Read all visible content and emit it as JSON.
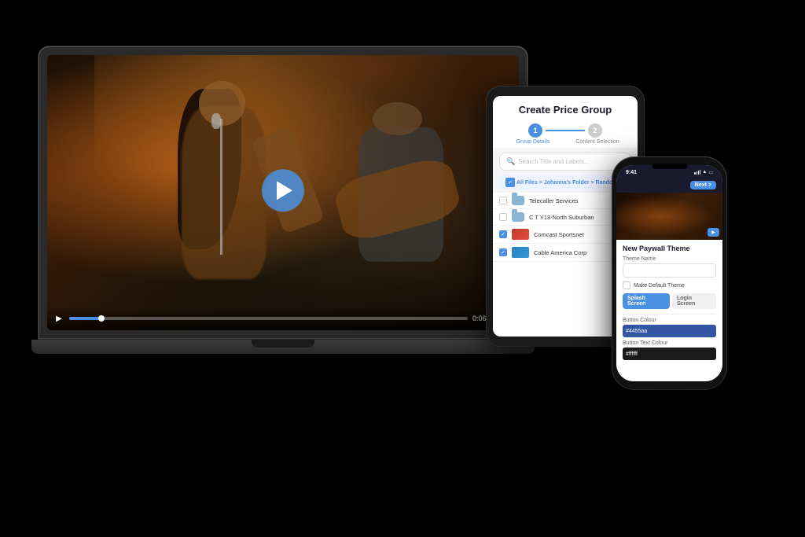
{
  "scene": {
    "background_color": "#000000"
  },
  "laptop": {
    "video": {
      "play_button_label": "▶",
      "controls": {
        "time": "0:06",
        "progress_percent": 8
      }
    }
  },
  "tablet": {
    "title": "Create Price Group",
    "stepper": {
      "step1_label": "Group Details",
      "step2_label": "Content Selection",
      "step1_number": "1",
      "step2_number": "2"
    },
    "search": {
      "placeholder": "Search Title and Labels..."
    },
    "breadcrumb": "All Files > Johanna's Folder > Random",
    "files": [
      {
        "name": "Telecaller Services",
        "type": "folder",
        "checked": false
      },
      {
        "name": "C T Y13-North Suburban",
        "type": "folder",
        "checked": false
      },
      {
        "name": "Comcast Sportsnet",
        "type": "video",
        "checked": true
      },
      {
        "name": "Cable America Corp",
        "type": "video",
        "checked": true
      }
    ]
  },
  "phone": {
    "status_bar": {
      "time": "9:41",
      "signal": "●●●"
    },
    "header": {
      "button_label": "Next >"
    },
    "video_thumbnail_label": "▶",
    "paywall_section": {
      "title": "New Paywall Theme",
      "theme_name_label": "Theme Name",
      "theme_name_placeholder": "",
      "default_theme_label": "Make Default Theme",
      "tabs": [
        {
          "label": "Splash Screen",
          "active": true
        },
        {
          "label": "Login Screen",
          "active": false
        }
      ],
      "button_colour_label": "Button Colour",
      "button_colour_value": "#4455aa",
      "button_text_colour_label": "Button Text Colour",
      "button_text_colour_value": "#ffffff"
    }
  }
}
